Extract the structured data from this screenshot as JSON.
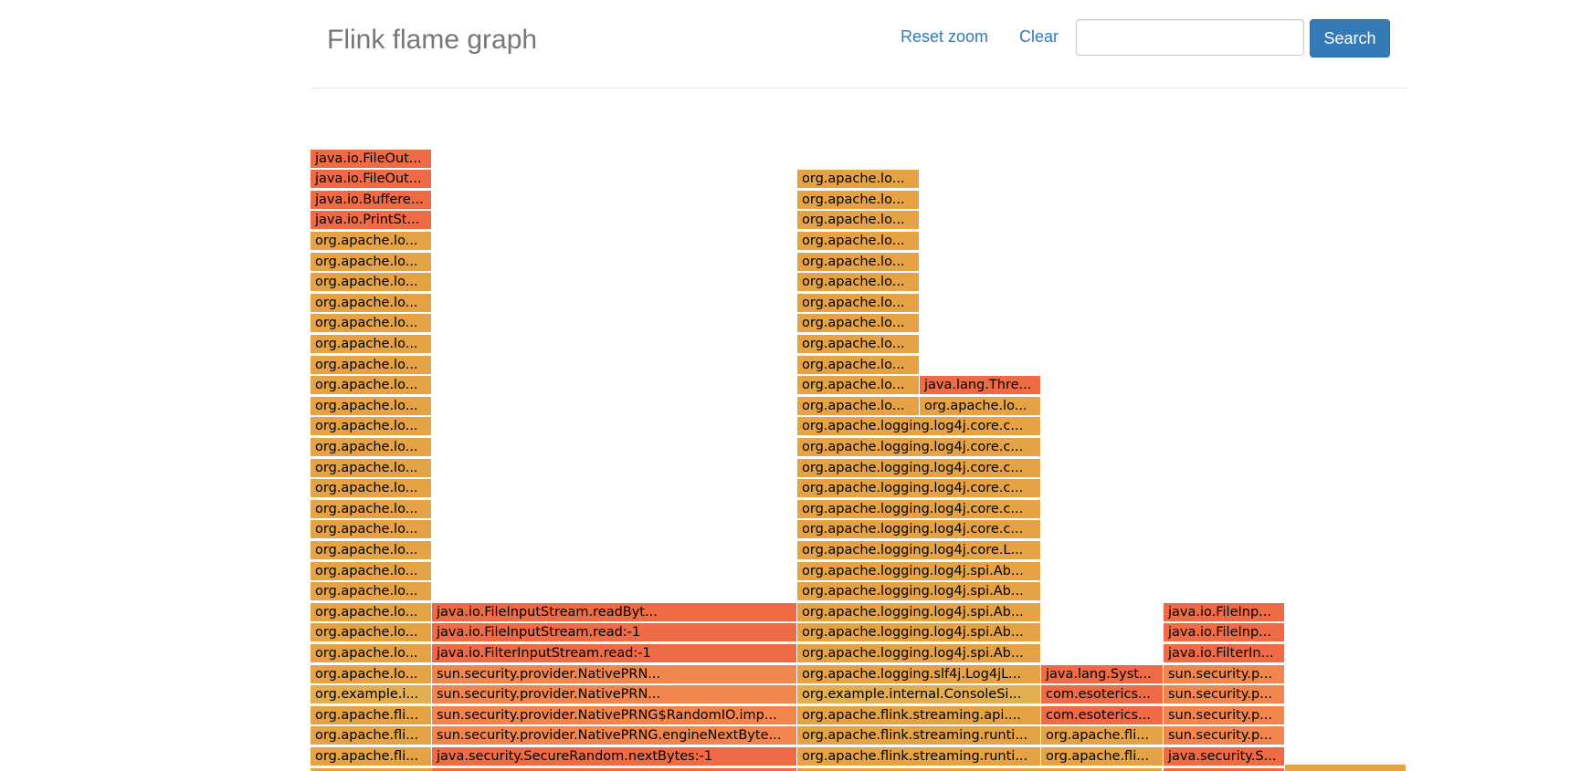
{
  "header": {
    "title": "Flink flame graph",
    "reset_zoom_label": "Reset zoom",
    "clear_label": "Clear",
    "search_value": "",
    "search_button_label": "Search"
  },
  "colors": {
    "orange": "#e5a345",
    "red": "#ee6b45",
    "red_orange": "#f0864e",
    "gold": "#e3ae50",
    "link": "#337ab7",
    "button": "#337ab7"
  },
  "flame_columns": [
    {
      "col": 0,
      "frames": [
        {
          "label": "org.apache.fli...",
          "color": "orange"
        },
        {
          "label": "org.apache.fli...",
          "color": "orange"
        },
        {
          "label": "org.apache.fli...",
          "color": "orange"
        },
        {
          "label": "org.example.i...",
          "color": "gold"
        },
        {
          "label": "org.apache.lo...",
          "color": "orange"
        },
        {
          "label": "org.apache.lo...",
          "color": "orange"
        },
        {
          "label": "org.apache.lo...",
          "color": "orange"
        },
        {
          "label": "org.apache.lo...",
          "color": "orange"
        },
        {
          "label": "org.apache.lo...",
          "color": "orange"
        },
        {
          "label": "org.apache.lo...",
          "color": "orange"
        },
        {
          "label": "org.apache.lo...",
          "color": "orange"
        },
        {
          "label": "org.apache.lo...",
          "color": "orange"
        },
        {
          "label": "org.apache.lo...",
          "color": "orange"
        },
        {
          "label": "org.apache.lo...",
          "color": "orange"
        },
        {
          "label": "org.apache.lo...",
          "color": "orange"
        },
        {
          "label": "org.apache.lo...",
          "color": "orange"
        },
        {
          "label": "org.apache.lo...",
          "color": "orange"
        },
        {
          "label": "org.apache.lo...",
          "color": "orange"
        },
        {
          "label": "org.apache.lo...",
          "color": "orange"
        },
        {
          "label": "org.apache.lo...",
          "color": "orange"
        },
        {
          "label": "org.apache.lo...",
          "color": "orange"
        },
        {
          "label": "org.apache.lo...",
          "color": "orange"
        },
        {
          "label": "org.apache.lo...",
          "color": "orange"
        },
        {
          "label": "org.apache.lo...",
          "color": "orange"
        },
        {
          "label": "org.apache.lo...",
          "color": "orange"
        },
        {
          "label": "org.apache.lo...",
          "color": "orange"
        },
        {
          "label": "java.io.PrintSt...",
          "color": "red"
        },
        {
          "label": "java.io.Buffere...",
          "color": "red"
        },
        {
          "label": "java.io.FileOut...",
          "color": "red"
        },
        {
          "label": "java.io.FileOut...",
          "color": "red"
        }
      ]
    },
    {
      "col": 1,
      "frames": [
        {
          "label": "java.security.SecureRandom.nextBytes:-1",
          "color": "red"
        },
        {
          "label": "sun.security.provider.NativePRNG.engineNextByte...",
          "color": "red_orange"
        },
        {
          "label": "sun.security.provider.NativePRNG$RandomIO.imp...",
          "color": "red_orange"
        },
        {
          "label": "sun.security.provider.NativePRN...",
          "color": "red_orange"
        },
        {
          "label": "sun.security.provider.NativePRN...",
          "color": "red_orange"
        },
        {
          "label": "java.io.FilterInputStream.read:-1",
          "color": "red"
        },
        {
          "label": "java.io.FileInputStream.read:-1",
          "color": "red"
        },
        {
          "label": "java.io.FileInputStream.readByt...",
          "color": "red"
        }
      ]
    },
    {
      "col": 2,
      "frames": [
        {
          "label": "org.apache.flink.streaming.runti...",
          "color": "orange"
        },
        {
          "label": "org.apache.flink.streaming.runti...",
          "color": "orange"
        },
        {
          "label": "org.apache.flink.streaming.api....",
          "color": "orange"
        },
        {
          "label": "org.example.internal.ConsoleSi...",
          "color": "gold"
        },
        {
          "label": "org.apache.logging.slf4j.Log4jL...",
          "color": "orange"
        },
        {
          "label": "org.apache.logging.log4j.spi.Ab...",
          "color": "orange"
        },
        {
          "label": "org.apache.logging.log4j.spi.Ab...",
          "color": "orange"
        },
        {
          "label": "org.apache.logging.log4j.spi.Ab...",
          "color": "orange"
        },
        {
          "label": "org.apache.logging.log4j.spi.Ab...",
          "color": "orange"
        },
        {
          "label": "org.apache.logging.log4j.spi.Ab...",
          "color": "orange"
        },
        {
          "label": "org.apache.logging.log4j.core.L...",
          "color": "orange"
        },
        {
          "label": "org.apache.logging.log4j.core.c...",
          "color": "orange"
        },
        {
          "label": "org.apache.logging.log4j.core.c...",
          "color": "orange"
        },
        {
          "label": "org.apache.logging.log4j.core.c...",
          "color": "orange"
        },
        {
          "label": "org.apache.logging.log4j.core.c...",
          "color": "orange"
        },
        {
          "label": "org.apache.logging.log4j.core.c...",
          "color": "orange"
        },
        {
          "label": "org.apache.logging.log4j.core.c...",
          "color": "orange"
        }
      ]
    },
    {
      "col": "2a",
      "frames": [
        {
          "label": "org.apache.lo...",
          "color": "orange"
        },
        {
          "label": "org.apache.lo...",
          "color": "orange"
        },
        {
          "label": "org.apache.lo...",
          "color": "orange"
        },
        {
          "label": "org.apache.lo...",
          "color": "orange"
        },
        {
          "label": "org.apache.lo...",
          "color": "orange"
        },
        {
          "label": "org.apache.lo...",
          "color": "orange"
        },
        {
          "label": "org.apache.lo...",
          "color": "orange"
        },
        {
          "label": "org.apache.lo...",
          "color": "orange"
        },
        {
          "label": "org.apache.lo...",
          "color": "orange"
        },
        {
          "label": "org.apache.lo...",
          "color": "orange"
        },
        {
          "label": "org.apache.lo...",
          "color": "orange"
        },
        {
          "label": "org.apache.lo...",
          "color": "orange"
        }
      ]
    },
    {
      "col": "2b",
      "frames": [
        {
          "label": "org.apache.lo...",
          "color": "orange"
        },
        {
          "label": "java.lang.Thre...",
          "color": "red"
        }
      ]
    },
    {
      "col": 3,
      "frames": [
        {
          "label": "org.apache.fli...",
          "color": "orange"
        },
        {
          "label": "org.apache.fli...",
          "color": "orange"
        },
        {
          "label": "com.esoterics...",
          "color": "red"
        },
        {
          "label": "com.esoterics...",
          "color": "red"
        },
        {
          "label": "java.lang.Syst...",
          "color": "red"
        }
      ]
    },
    {
      "col": 4,
      "frames": [
        {
          "label": "java.security.S...",
          "color": "red"
        },
        {
          "label": "sun.security.p...",
          "color": "red_orange"
        },
        {
          "label": "sun.security.p...",
          "color": "red_orange"
        },
        {
          "label": "sun.security.p...",
          "color": "red_orange"
        },
        {
          "label": "sun.security.p...",
          "color": "red_orange"
        },
        {
          "label": "java.io.FilterIn...",
          "color": "red"
        },
        {
          "label": "java.io.FileInp...",
          "color": "red"
        },
        {
          "label": "java.io.FileInp...",
          "color": "red"
        }
      ]
    }
  ]
}
